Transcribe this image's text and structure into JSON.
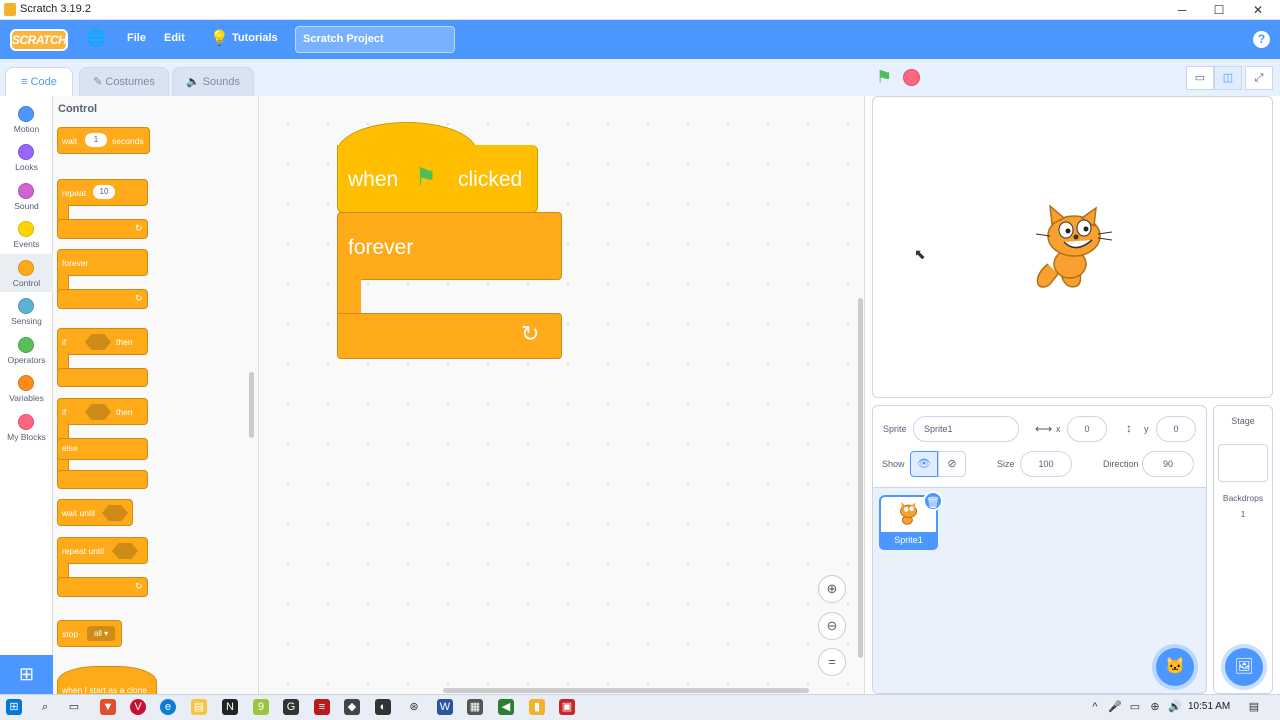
{
  "window": {
    "title": "Scratch 3.19.2",
    "minimize": "─",
    "maximize": "☐",
    "close": "✕"
  },
  "menubar": {
    "logo": "SCRATCH",
    "globe": "🌐",
    "file": "File",
    "edit": "Edit",
    "tutorials": "Tutorials",
    "project_title": "Scratch Project",
    "help": "?"
  },
  "tabs": [
    {
      "label": "Code",
      "icon": "≡"
    },
    {
      "label": "Costumes",
      "icon": "✎"
    },
    {
      "label": "Sounds",
      "icon": "🔈"
    }
  ],
  "categories": [
    {
      "label": "Motion",
      "color": "#4c97ff"
    },
    {
      "label": "Looks",
      "color": "#9966ff"
    },
    {
      "label": "Sound",
      "color": "#cf63cf"
    },
    {
      "label": "Events",
      "color": "#ffd500"
    },
    {
      "label": "Control",
      "color": "#ffab19"
    },
    {
      "label": "Sensing",
      "color": "#5cb1d6"
    },
    {
      "label": "Operators",
      "color": "#59c059"
    },
    {
      "label": "Variables",
      "color": "#ff8c1a"
    },
    {
      "label": "My Blocks",
      "color": "#ff6680"
    }
  ],
  "palette": {
    "title": "Control",
    "wait": {
      "pre": "wait",
      "value": "1",
      "post": "seconds"
    },
    "repeat": {
      "label": "repeat",
      "value": "10"
    },
    "forever": "forever",
    "if_then": {
      "if": "if",
      "then": "then"
    },
    "if_else": {
      "if": "if",
      "then": "then",
      "else": "else"
    },
    "wait_until": "wait until",
    "repeat_until": "repeat until",
    "stop": {
      "label": "stop",
      "value": "all ▾"
    },
    "clone_hat": "when I start as a clone",
    "loop_arrow": "↻"
  },
  "script": {
    "when": "when",
    "flag": "⚑",
    "clicked": "clicked",
    "forever": "forever",
    "loop_arrow": "↻"
  },
  "zoom": {
    "in": "⊕",
    "out": "⊖",
    "reset": "="
  },
  "stage_controls": {
    "flag": "⚑",
    "small": "▭",
    "normal": "◫",
    "full": "⤢"
  },
  "sprite_info": {
    "sprite_label": "Sprite",
    "sprite_name": "Sprite1",
    "x_icon": "⟷",
    "x_label": "x",
    "x_value": "0",
    "y_icon": "↕",
    "y_label": "y",
    "y_value": "0",
    "show_label": "Show",
    "show_on": "👁",
    "show_off": "⊘",
    "size_label": "Size",
    "size_value": "100",
    "direction_label": "Direction",
    "direction_value": "90"
  },
  "sprite_list": [
    {
      "name": "Sprite1",
      "delete": "🗑"
    }
  ],
  "stage_pane": {
    "title": "Stage",
    "backdrops_label": "Backdrops",
    "backdrops_count": "1"
  },
  "add_sprite": "🐱",
  "add_backdrop": "🖼",
  "extension": "⊞",
  "taskbar": {
    "time": "10:51 AM"
  }
}
